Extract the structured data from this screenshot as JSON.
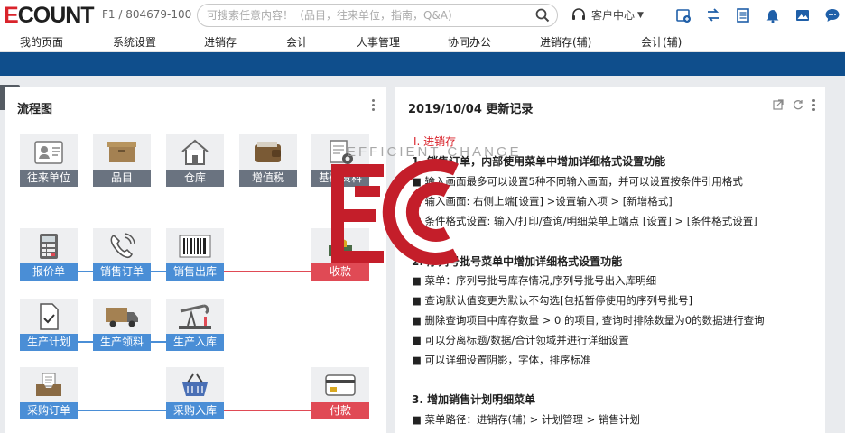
{
  "brand": {
    "logo_text_1": "E",
    "logo_text_2": "COUNT"
  },
  "account": "F1 / 804679-100",
  "search": {
    "placeholder": "可搜索任意内容！（品目，往来单位，指南，Q&A)"
  },
  "customer_center": "客户中心",
  "menu": [
    "我的页面",
    "系统设置",
    "进销存",
    "会计",
    "人事管理",
    "协同办公",
    "进销存(辅)",
    "会计(辅)"
  ],
  "side_tab": "⇆",
  "flow": {
    "title": "流程图",
    "tiles": {
      "customer": "往来单位",
      "item": "品目",
      "warehouse": "仓库",
      "vat": "增值税",
      "basic": "基础资料",
      "quote": "报价单",
      "sales_order": "销售订单",
      "sales_out": "销售出库",
      "receipt": "收款",
      "prod_plan": "生产计划",
      "prod_issue": "生产领料",
      "prod_in": "生产入库",
      "purchase_order": "采购订单",
      "purchase_in": "采购入库",
      "payment": "付款"
    }
  },
  "updates": {
    "title": "2019/10/04  更新记录",
    "section": "Ⅰ. 进销存",
    "lines": [
      "1. 销售订单，内部使用菜单中增加详细格式设置功能",
      "■ 输入画面最多可以设置5种不同输入画面，并可以设置按条件引用格式",
      "■ 输入画面: 右侧上端[设置] >设置输入项 > [新增格式]",
      "■ 条件格式设置: 输入/打印/查询/明细菜单上端点 [设置] > [条件格式设置]",
      "2. 序列号批号菜单中增加详细格式设置功能",
      "■ 菜单：序列号批号库存情况,序列号批号出入库明细",
      "■ 查询默认值变更为默认不勾选[包括暂停使用的序列号批号]",
      "■ 删除查询项目中库存数量 > 0 的项目, 查询时排除数量为0的数据进行查询",
      "■ 可以分离标题/数据/合计领域并进行详细设置",
      "■ 可以详细设置阴影，字体，排序标准",
      "3. 增加销售计划明细菜单",
      "■ 菜单路径：进销存(辅) > 计划管理 > 销售计划"
    ]
  },
  "watermark": {
    "text": "EFFICIENT CHANGE"
  },
  "colors": {
    "nav_blue": "#0f4e8c",
    "tile_blue": "#4a8ed6",
    "tile_red": "#e04a55",
    "tile_gray": "#6a7380",
    "brand_red": "#d9232b"
  }
}
